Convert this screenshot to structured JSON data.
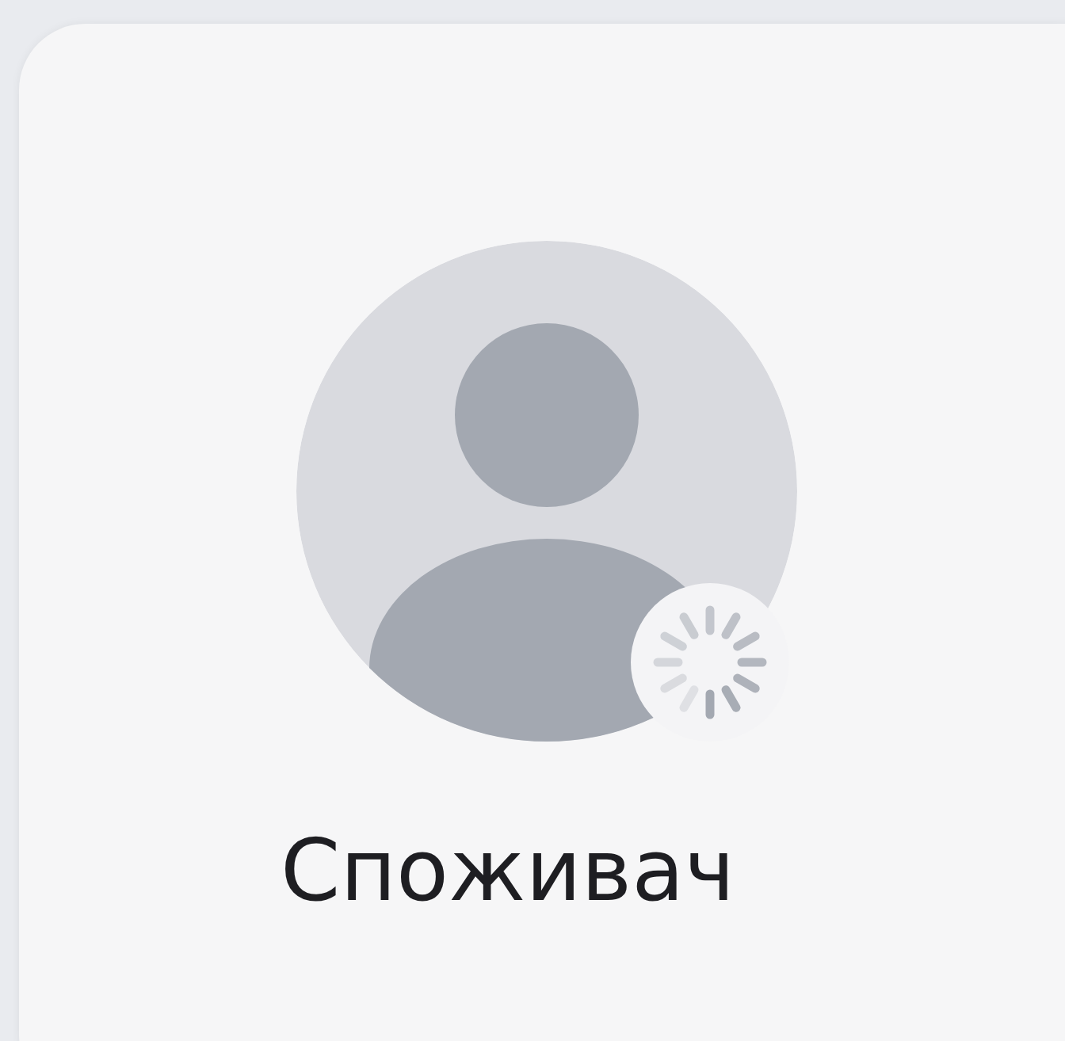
{
  "profile": {
    "name": "Споживач",
    "loading": true
  }
}
